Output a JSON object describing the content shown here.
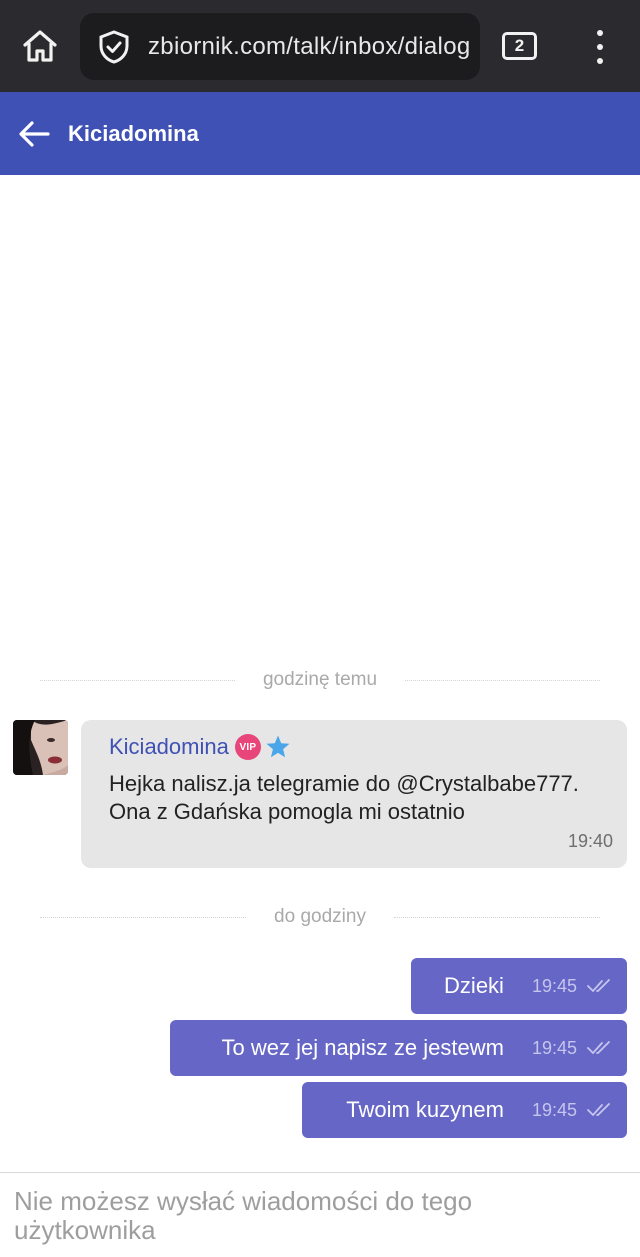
{
  "browser": {
    "url": "zbiornik.com/talk/inbox/dialog",
    "tab_count": "2",
    "icons": {
      "home": "home-icon",
      "security": "shield-check-icon",
      "menu": "more-vert-icon"
    }
  },
  "header": {
    "title": "Kiciadomina",
    "back_icon": "arrow-left-icon",
    "color": "#3f51b5"
  },
  "conversation": {
    "divider_1": "godzinę temu",
    "incoming": {
      "sender": "Kiciadomina",
      "vip_label": "VIP",
      "star_icon": "star-icon",
      "text": "Hejka nalisz.ja telegramie do @Crystalbabe777. Ona z Gdańska pomogla mi ostatnio",
      "time": "19:40"
    },
    "divider_2": "do godziny",
    "outgoing": [
      {
        "text": "Dzieki",
        "time": "19:45"
      },
      {
        "text": "To wez jej napisz ze jestewm",
        "time": "19:45"
      },
      {
        "text": "Twoim kuzynem",
        "time": "19:45"
      }
    ],
    "outgoing_color": "#6666c6"
  },
  "composer": {
    "disabled_text": "Nie możesz wysłać wiadomości do tego użytkownika"
  }
}
